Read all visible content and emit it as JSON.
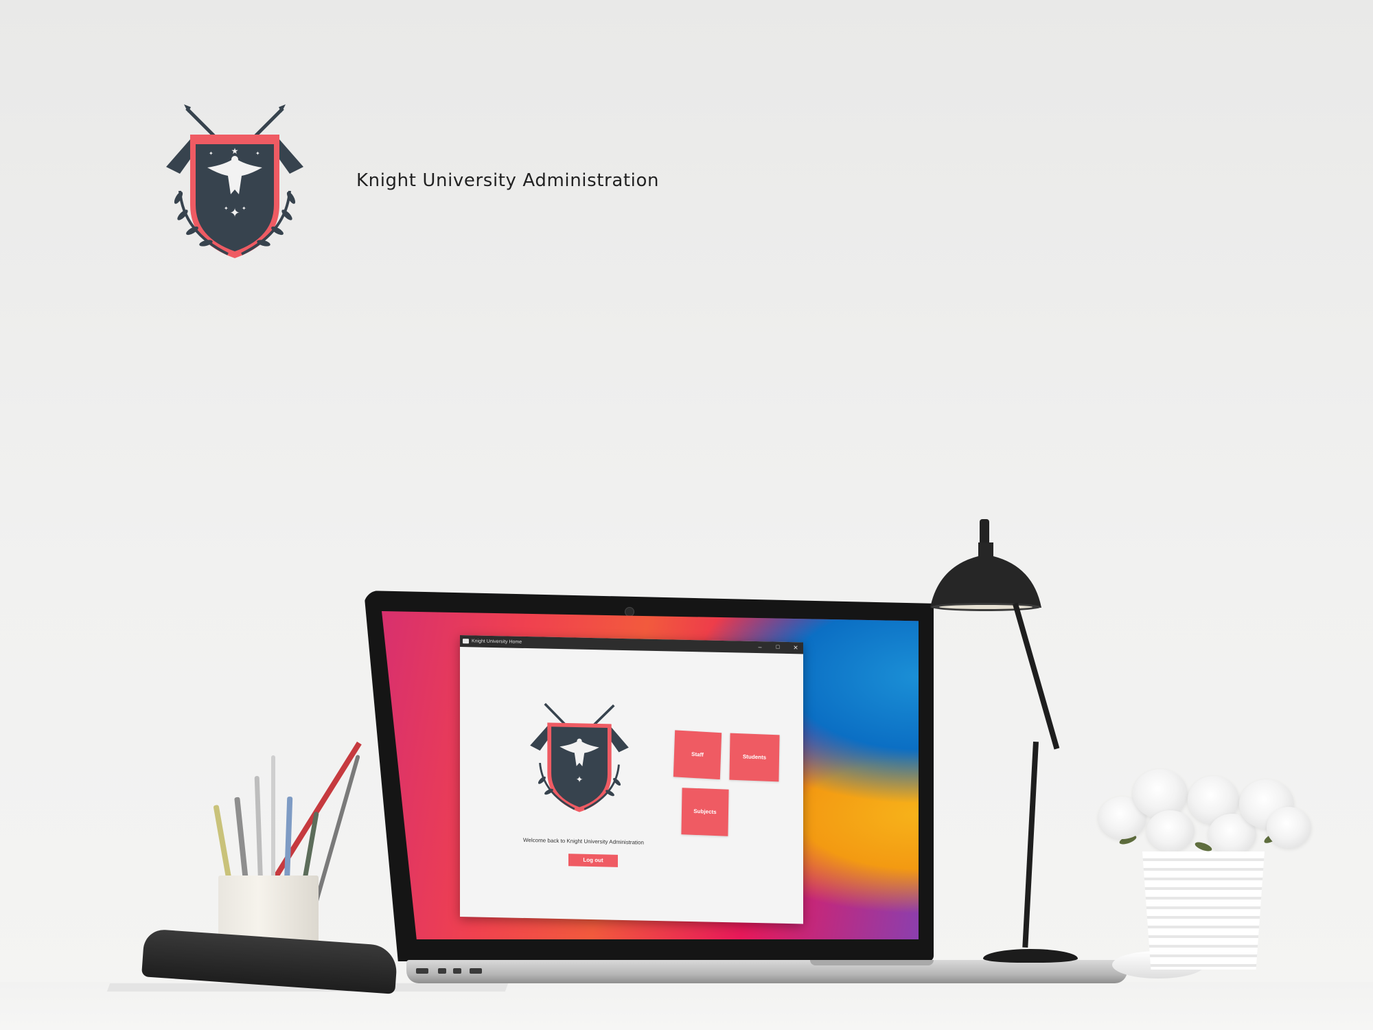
{
  "header": {
    "brand_title": "Knight University Administration"
  },
  "app": {
    "window_title": "Knight University Home",
    "controls": {
      "minimize": "–",
      "maximize": "☐",
      "close": "✕"
    },
    "welcome_text": "Welcome back to Knight University Administration",
    "logout_label": "Log out",
    "tiles": {
      "staff": "Staff",
      "students": "Students",
      "subjects": "Subjects"
    }
  },
  "colors": {
    "accent": "#ef5b63",
    "crest_navy": "#37434e",
    "crest_red": "#ef5b63",
    "titlebar": "#2d2d2d"
  },
  "icons": [
    "university-crest-icon",
    "app-window-icon",
    "minimize-icon",
    "maximize-icon",
    "close-icon"
  ]
}
